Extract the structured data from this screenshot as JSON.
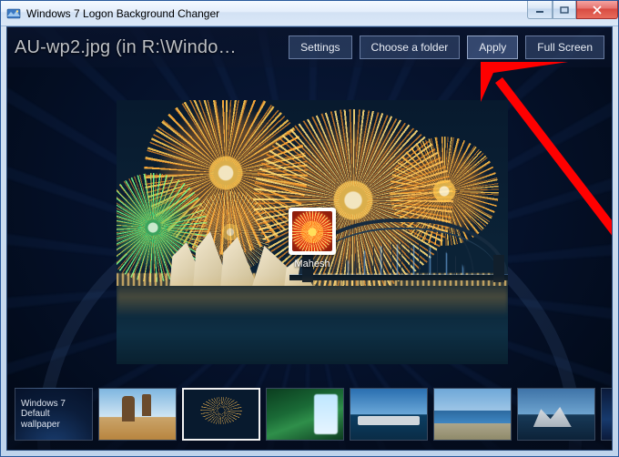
{
  "window": {
    "title": "Windows 7 Logon Background Changer"
  },
  "toolbar": {
    "current_file_label": "AU-wp2.jpg (in R:\\Windo…",
    "settings_label": "Settings",
    "choose_folder_label": "Choose a folder",
    "apply_label": "Apply",
    "fullscreen_label": "Full Screen"
  },
  "preview": {
    "user_name": "Mahesh"
  },
  "thumbnails": {
    "default_line1": "Windows 7",
    "default_line2": "Default",
    "default_line3": "wallpaper"
  }
}
